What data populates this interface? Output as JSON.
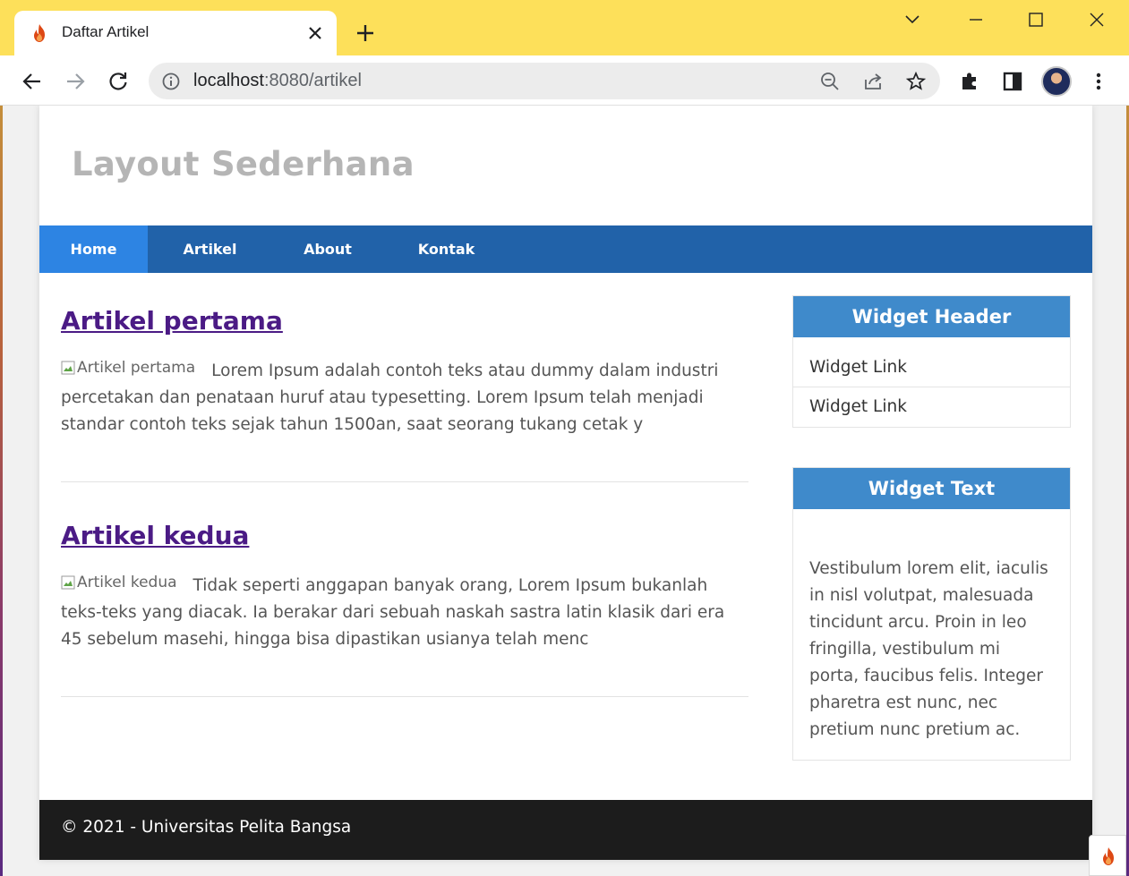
{
  "browser": {
    "tab_title": "Daftar Artikel",
    "url_host": "localhost",
    "url_rest": ":8080/artikel",
    "titlebar_color": "#fde05a"
  },
  "icons": {
    "favicon": "codeigniter-flame-icon",
    "close": "close-icon",
    "new_tab": "plus-icon",
    "back": "arrow-left-icon",
    "forward": "arrow-right-icon",
    "reload": "reload-icon",
    "site_info": "info-icon",
    "zoom": "zoom-out-icon",
    "share": "share-icon",
    "bookmark": "star-icon",
    "extensions": "puzzle-icon",
    "side_panel": "side-panel-icon",
    "menu": "kebab-menu-icon"
  },
  "site": {
    "title": "Layout Sederhana"
  },
  "nav": {
    "items": [
      {
        "label": "Home"
      },
      {
        "label": "Artikel"
      },
      {
        "label": "About"
      },
      {
        "label": "Kontak"
      }
    ],
    "bar_color": "#2162a9",
    "active_color": "#2d84e3"
  },
  "articles": [
    {
      "title": "Artikel pertama",
      "img_alt": "Artikel pertama",
      "excerpt": "Lorem Ipsum adalah contoh teks atau dummy dalam industri percetakan dan penataan huruf atau typesetting. Lorem Ipsum telah menjadi standar contoh teks sejak tahun 1500an, saat seorang tukang cetak y"
    },
    {
      "title": "Artikel kedua",
      "img_alt": "Artikel kedua",
      "excerpt": "Tidak seperti anggapan banyak orang, Lorem Ipsum bukanlah teks-teks yang diacak. Ia berakar dari sebuah naskah sastra latin klasik dari era 45 sebelum masehi, hingga bisa dipastikan usianya telah menc"
    }
  ],
  "sidebar": {
    "widget1": {
      "header": "Widget Header",
      "links": [
        {
          "label": "Widget Link"
        },
        {
          "label": "Widget Link"
        }
      ]
    },
    "widget2": {
      "header": "Widget Text",
      "text": "Vestibulum lorem elit, iaculis in nisl volutpat, malesuada tincidunt arcu. Proin in leo fringilla, vestibulum mi porta, faucibus felis. Integer pharetra est nunc, nec pretium nunc pretium ac."
    },
    "header_color": "#3f8acb"
  },
  "footer": {
    "text": "© 2021 - Universitas Pelita Bangsa"
  }
}
